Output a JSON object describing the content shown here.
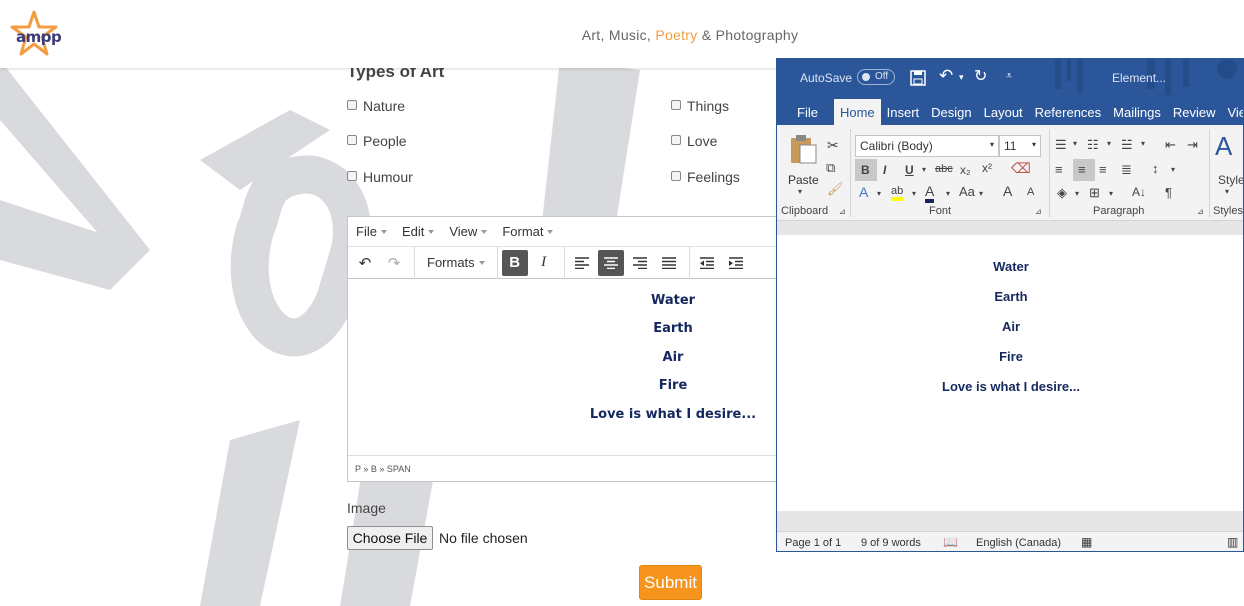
{
  "header": {
    "logo_text": "ampp",
    "tagline_part1": "Art, Music, ",
    "tagline_accent": "Poetry",
    "tagline_part2": " & Photography"
  },
  "form": {
    "section_title": "Types of Art",
    "checkboxes": [
      "Nature",
      "Things",
      "People",
      "Love",
      "Humour",
      "Feelings"
    ]
  },
  "editor": {
    "menus": [
      "File",
      "Edit",
      "View",
      "Format"
    ],
    "formats_label": "Formats",
    "lines": [
      "Water",
      "Earth",
      "Air",
      "Fire",
      "Love is what I desire..."
    ],
    "status_path": "P » B » SPAN"
  },
  "image_field": {
    "label": "Image",
    "button_label": "Choose File",
    "no_file_text": "No file chosen"
  },
  "submit_label": "Submit",
  "word": {
    "autosave_label": "AutoSave",
    "autosave_state": "Off",
    "window_title": "Element...",
    "tabs": [
      "File",
      "Home",
      "Insert",
      "Design",
      "Layout",
      "References",
      "Mailings",
      "Review",
      "View"
    ],
    "active_tab": "Home",
    "font_name": "Calibri (Body)",
    "font_size": "11",
    "paste_label": "Paste",
    "styles_label": "Style",
    "groups": [
      "Clipboard",
      "Font",
      "Paragraph",
      "Styles"
    ],
    "doc_lines": [
      "Water",
      "Earth",
      "Air",
      "Fire",
      "Love is what I desire..."
    ],
    "status_page": "Page 1 of 1",
    "status_words": "9 of 9 words",
    "status_language": "English (Canada)",
    "colors": {
      "brand": "#2b579a",
      "text": "#14285f",
      "accent": "#f7941d"
    }
  }
}
